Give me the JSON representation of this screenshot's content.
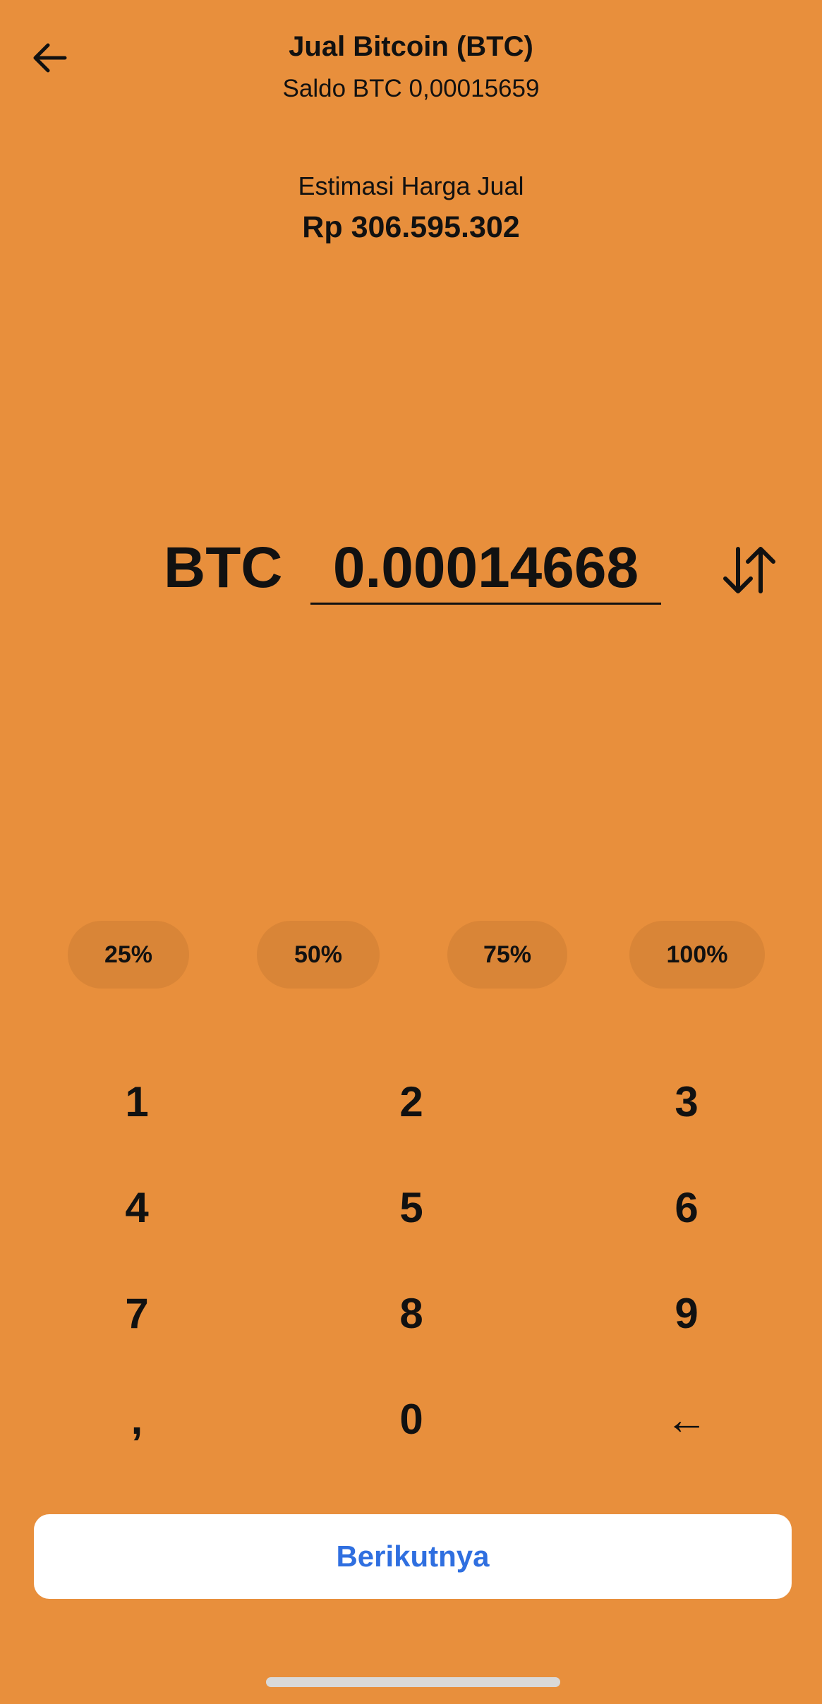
{
  "header": {
    "back_icon": "arrow-left-icon",
    "title": "Jual Bitcoin (BTC)",
    "balance": "Saldo BTC 0,00015659"
  },
  "estimate": {
    "label": "Estimasi Harga Jual",
    "value": "Rp 306.595.302"
  },
  "amount": {
    "currency": "BTC",
    "value": "0.00014668",
    "swap_icon": "swap-vertical-icon"
  },
  "percent_buttons": [
    "25%",
    "50%",
    "75%",
    "100%"
  ],
  "keypad": {
    "keys": [
      "1",
      "2",
      "3",
      "4",
      "5",
      "6",
      "7",
      "8",
      "9",
      ",",
      "0",
      "←"
    ]
  },
  "next_button": {
    "label": "Berikutnya"
  },
  "colors": {
    "background": "#e88f3c",
    "pill": "#d98537",
    "button_bg": "#ffffff",
    "button_text": "#2f6fe0",
    "text": "#111111"
  }
}
